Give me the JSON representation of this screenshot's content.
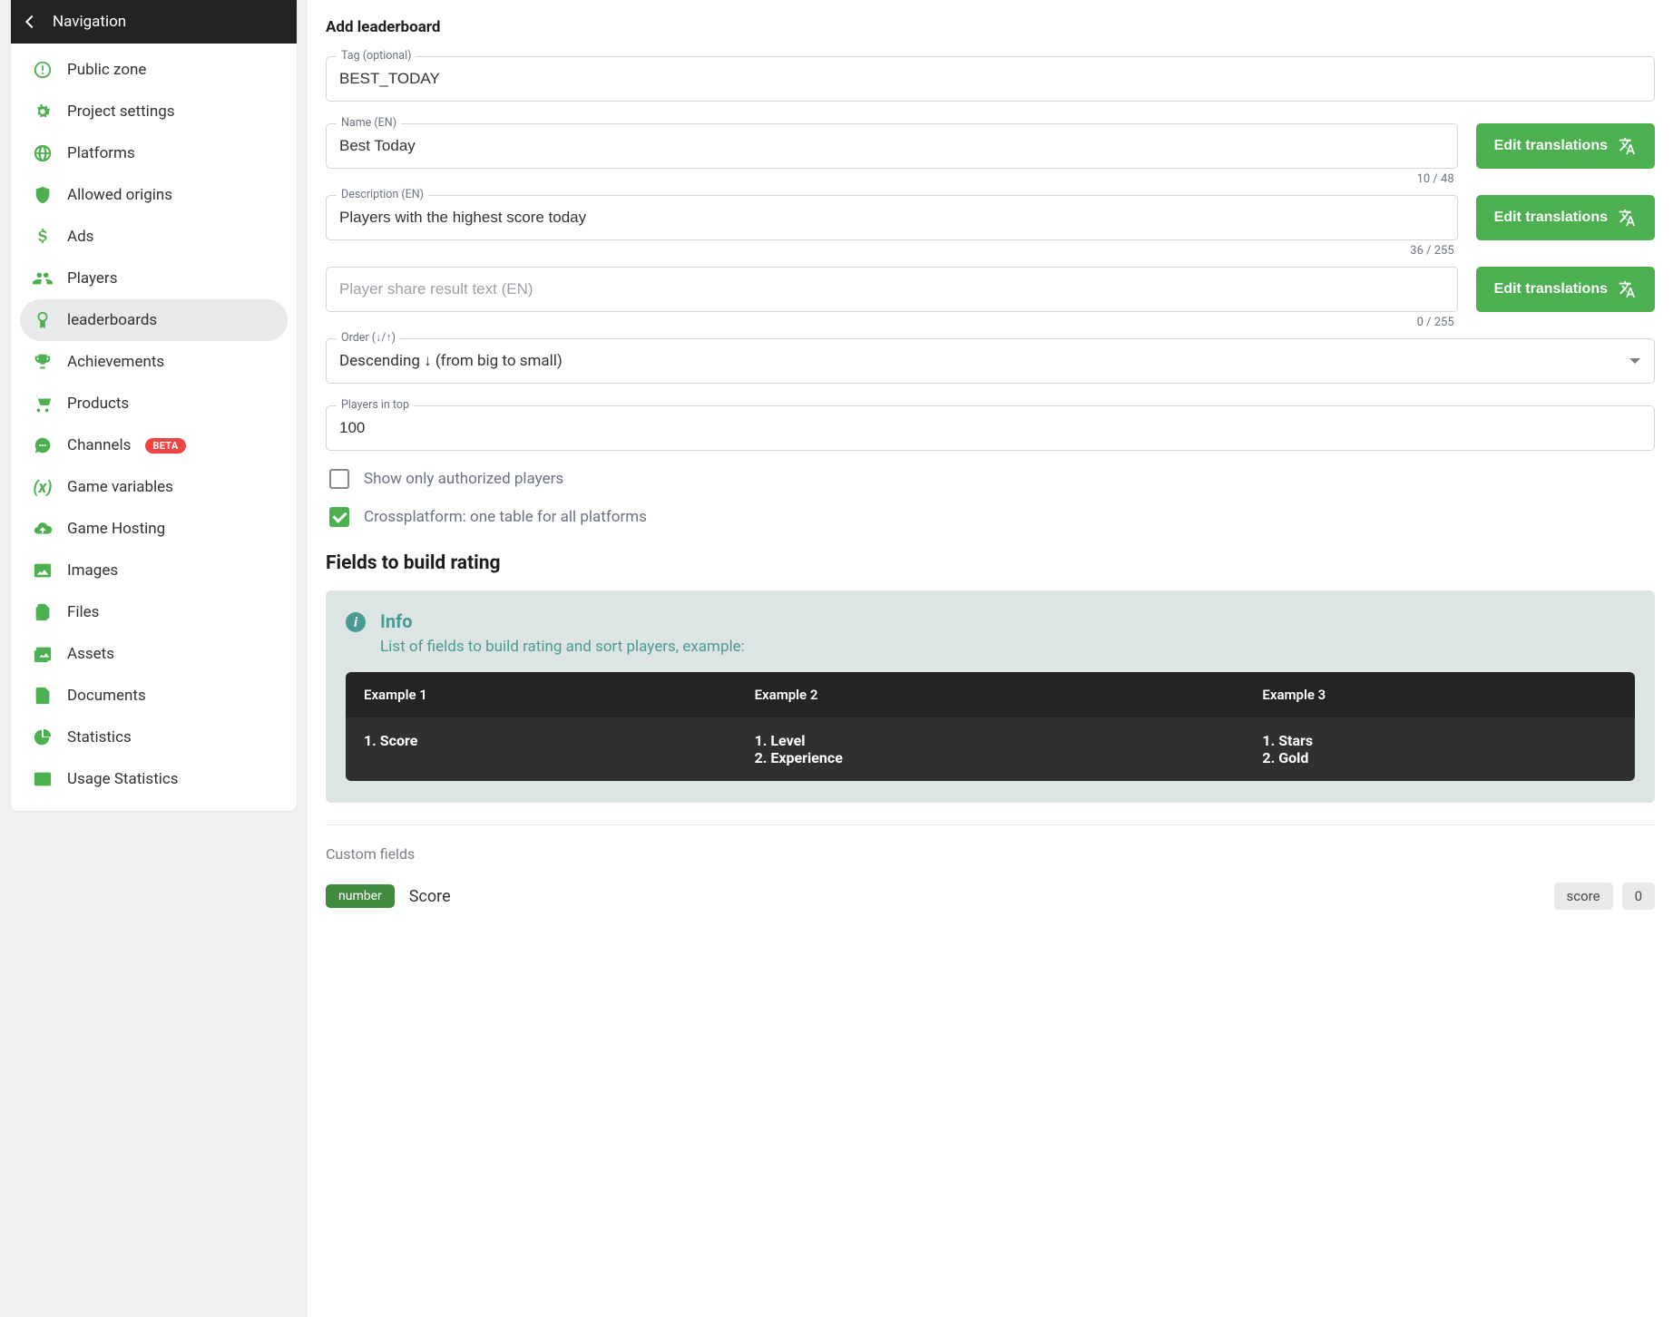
{
  "sidebar": {
    "header": "Navigation",
    "items": [
      {
        "label": "Public zone"
      },
      {
        "label": "Project settings"
      },
      {
        "label": "Platforms"
      },
      {
        "label": "Allowed origins"
      },
      {
        "label": "Ads"
      },
      {
        "label": "Players"
      },
      {
        "label": "leaderboards"
      },
      {
        "label": "Achievements"
      },
      {
        "label": "Products"
      },
      {
        "label": "Channels",
        "badge": "BETA"
      },
      {
        "label": "Game variables"
      },
      {
        "label": "Game Hosting"
      },
      {
        "label": "Images"
      },
      {
        "label": "Files"
      },
      {
        "label": "Assets"
      },
      {
        "label": "Documents"
      },
      {
        "label": "Statistics"
      },
      {
        "label": "Usage Statistics"
      }
    ]
  },
  "page": {
    "title": "Add leaderboard",
    "tag_label": "Tag (optional)",
    "tag_value": "BEST_TODAY",
    "name_label": "Name (EN)",
    "name_value": "Best Today",
    "name_counter": "10 / 48",
    "desc_label": "Description (EN)",
    "desc_value": "Players with the highest score today",
    "desc_counter": "36 / 255",
    "share_placeholder": "Player share result text (EN)",
    "share_counter": "0 / 255",
    "translate_btn": "Edit translations",
    "order_label": "Order (↓/↑)",
    "order_value": "Descending ↓ (from big to small)",
    "top_label": "Players in top",
    "top_value": "100",
    "cb_authorized": "Show only authorized players",
    "cb_crossplatform": "Crossplatform: one table for all platforms",
    "fields_section": "Fields to build rating",
    "info": {
      "title": "Info",
      "text": "List of fields to build rating and sort players, example:",
      "headers": [
        "Example 1",
        "Example 2",
        "Example 3"
      ],
      "col1": "1. Score",
      "col2a": "1. Level",
      "col2b": "2. Experience",
      "col3a": "1. Stars",
      "col3b": "2. Gold"
    },
    "custom_label": "Custom fields",
    "field_type": "number",
    "field_name": "Score",
    "pill_key": "score",
    "pill_val": "0"
  }
}
